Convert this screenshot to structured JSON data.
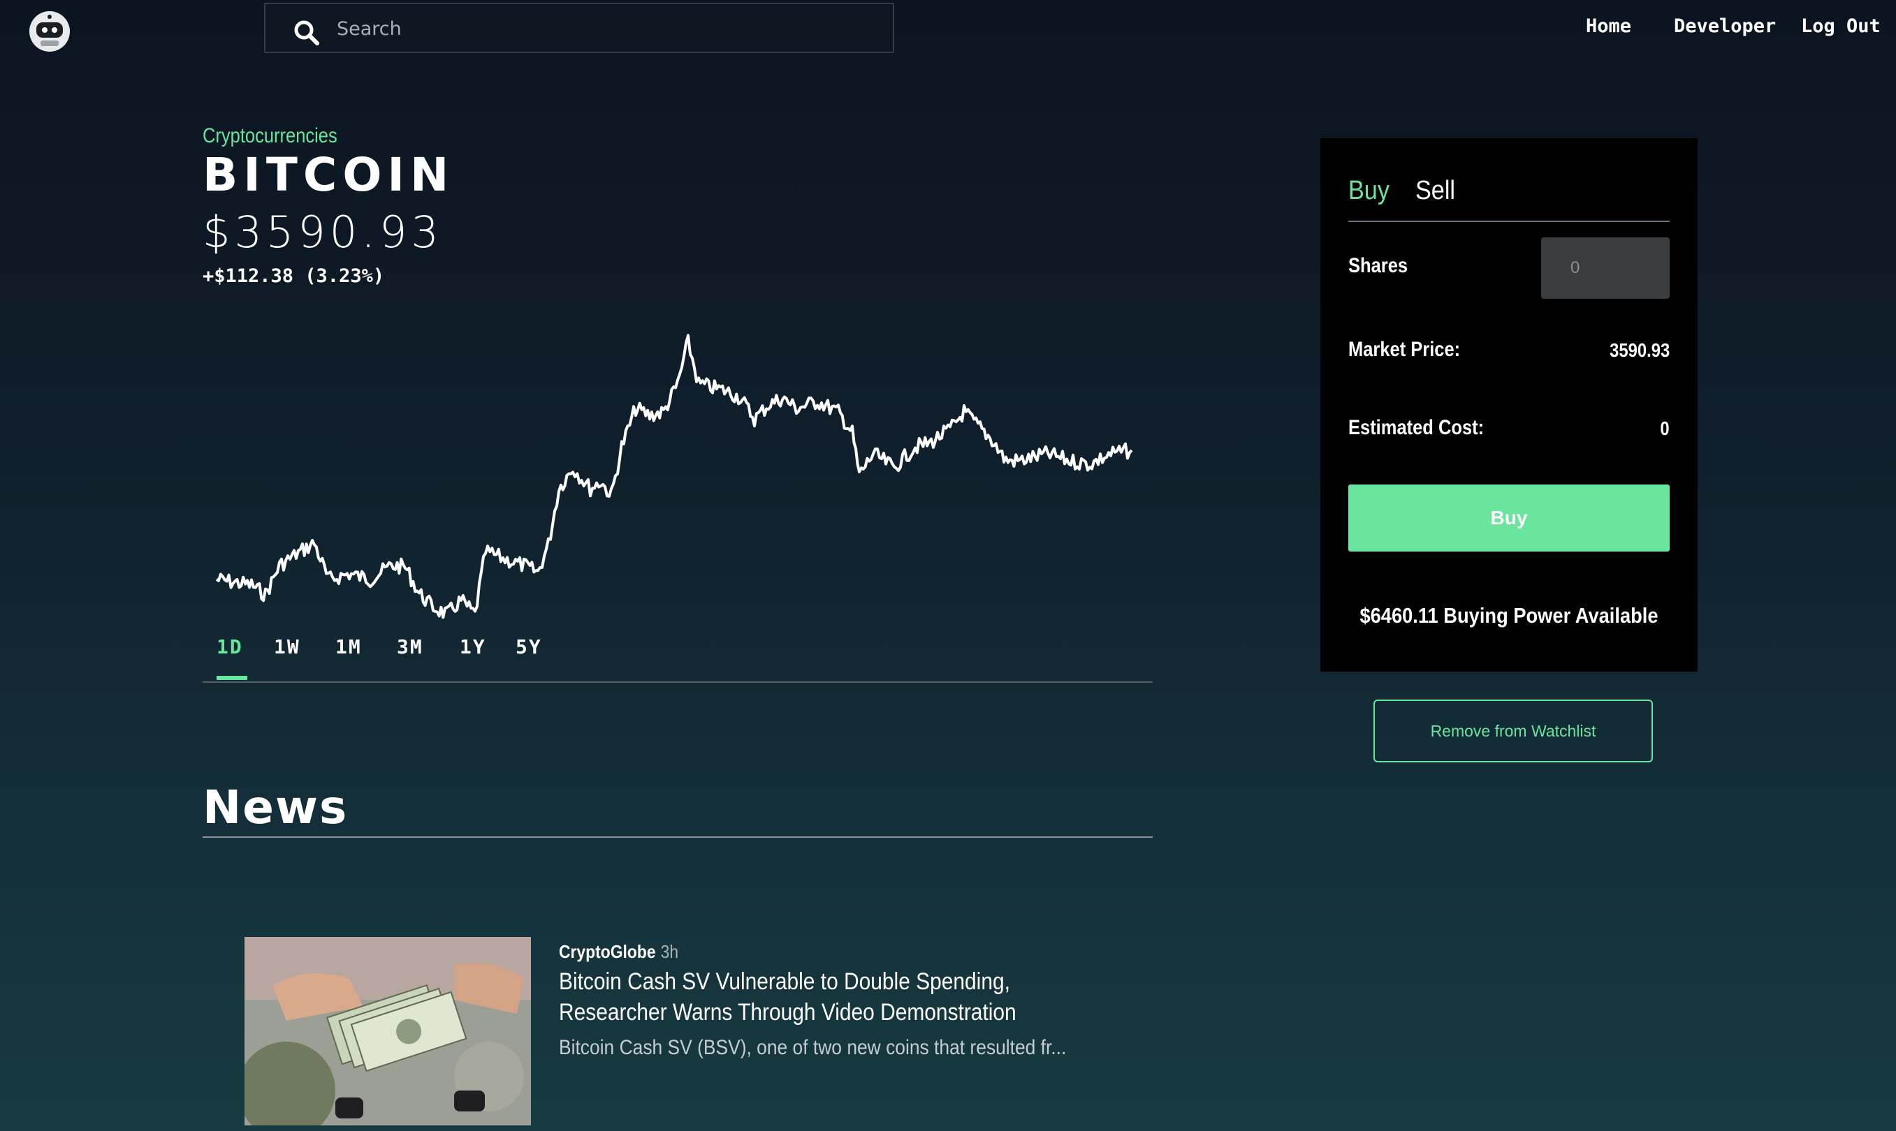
{
  "header": {
    "logo_icon": "astronaut-logo-icon",
    "search": {
      "placeholder": "Search",
      "value": "",
      "icon": "search-icon"
    },
    "nav": [
      {
        "label": "Home"
      },
      {
        "label": "Developer"
      },
      {
        "label": "Log Out"
      }
    ]
  },
  "asset": {
    "category": "Cryptocurrencies",
    "name": "BITCOIN",
    "price": "$3590.93",
    "change": "+$112.38 (3.23%)"
  },
  "chart": {
    "line_color": "#ffffff",
    "ranges": [
      "1D",
      "1W",
      "1M",
      "3M",
      "1Y",
      "5Y"
    ],
    "active_range": "1D",
    "accent": "#69e59d"
  },
  "news": {
    "title": "News",
    "articles": [
      {
        "source": "CryptoGlobe",
        "time": "3h",
        "headline": "Bitcoin Cash SV Vulnerable to Double Spending, Researcher Warns Through Video Demonstration",
        "snippet": "Bitcoin Cash SV (BSV), one of two new coins that resulted fr..."
      }
    ]
  },
  "order": {
    "tabs": {
      "buy": "Buy",
      "sell": "Sell"
    },
    "active_tab": "Buy",
    "shares_label": "Shares",
    "shares_placeholder": "0",
    "market_price_label": "Market Price:",
    "market_price_value": "3590.93",
    "estimated_cost_label": "Estimated Cost:",
    "estimated_cost_value": "0",
    "buy_button": "Buy",
    "buying_power": "$6460.11 Buying Power Available"
  },
  "watchlist_button": "Remove from Watchlist",
  "colors": {
    "accent": "#69e59d",
    "panel": "#000000",
    "background_top": "#0b1420",
    "background_bottom": "#173a40"
  }
}
